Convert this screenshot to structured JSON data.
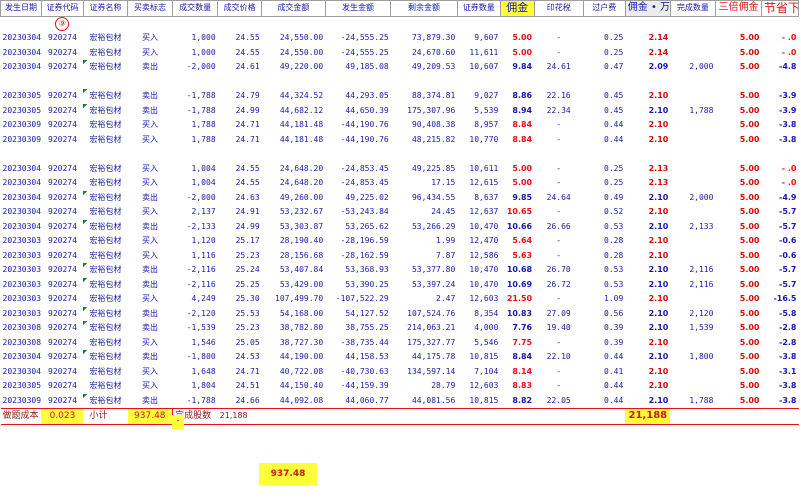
{
  "headers": [
    "发生日期",
    "证券代码",
    "证券名称",
    "买卖标志",
    "成交数量",
    "成交价格",
    "成交金额",
    "发生金额",
    "剩余金额",
    "证券数量",
    "佣金",
    "印花税",
    "过户费",
    "佣金 • 万",
    "完成数量",
    "三倍佣金",
    "节省下"
  ],
  "circle_marker": "⑨",
  "rows": [
    [
      "20230304",
      "920274",
      "宏裕包材",
      "买入",
      "1,000",
      "24.55",
      "24,550.00",
      "-24,555.25",
      "73,879.30",
      "9,607",
      "5.00",
      "-",
      "0.25",
      "2.14",
      "",
      "5.00",
      "- .0"
    ],
    [
      "20230304",
      "920274",
      "宏裕包材",
      "买入",
      "1,000",
      "24.55",
      "24,550.00",
      "-24,555.25",
      "24,670.60",
      "11,611",
      "5.00",
      "-",
      "0.25",
      "2.14",
      "",
      "5.00",
      "- .0"
    ],
    [
      "20230304",
      "920274",
      "宏裕包材",
      "卖出",
      "-2,000",
      "24.61",
      "49,220.00",
      "49,185.08",
      "49,209.53",
      "10,607",
      "9.84",
      "24.61",
      "0.47",
      "2.09",
      "2,000",
      "5.00",
      "-4.8"
    ],
    null,
    [
      "20230305",
      "920274",
      "宏裕包材",
      "卖出",
      "-1,788",
      "24.79",
      "44,324.52",
      "44,293.05",
      "88,374.81",
      "9,027",
      "8.86",
      "22.16",
      "0.45",
      "2.10",
      "",
      "5.00",
      "-3.9"
    ],
    [
      "20230305",
      "920274",
      "宏裕包材",
      "卖出",
      "-1,788",
      "24.99",
      "44,682.12",
      "44,650.39",
      "175,307.96",
      "5,539",
      "8.94",
      "22.34",
      "0.45",
      "2.10",
      "1,788",
      "5.00",
      "-3.9"
    ],
    [
      "20230309",
      "920274",
      "宏裕包材",
      "买入",
      "1,788",
      "24.71",
      "44,181.48",
      "-44,190.76",
      "90,408.38",
      "8,957",
      "8.84",
      "-",
      "0.44",
      "2.10",
      "",
      "5.00",
      "-3.8"
    ],
    [
      "20230309",
      "920274",
      "宏裕包材",
      "买入",
      "1,788",
      "24.71",
      "44,181.48",
      "-44,190.76",
      "48,215.82",
      "10,770",
      "8.84",
      "-",
      "0.44",
      "2.10",
      "",
      "5.00",
      "-3.8"
    ],
    null,
    [
      "20230304",
      "920274",
      "宏裕包材",
      "买入",
      "1,004",
      "24.55",
      "24,648.20",
      "-24,853.45",
      "49,225.85",
      "10,611",
      "5.00",
      "-",
      "0.25",
      "2.13",
      "",
      "5.00",
      "- .0"
    ],
    [
      "20230304",
      "920274",
      "宏裕包材",
      "买入",
      "1,004",
      "24.55",
      "24,648.20",
      "-24,853.45",
      "17.15",
      "12,615",
      "5.00",
      "-",
      "0.25",
      "2.13",
      "",
      "5.00",
      "- .0"
    ],
    [
      "20230304",
      "920274",
      "宏裕包材",
      "卖出",
      "-2,000",
      "24.63",
      "49,260.00",
      "49,225.02",
      "96,434.55",
      "8,637",
      "9.85",
      "24.64",
      "0.49",
      "2.10",
      "2,000",
      "5.00",
      "-4.9"
    ],
    [
      "20230304",
      "920274",
      "宏裕包材",
      "买入",
      "2,137",
      "24.91",
      "53,232.67",
      "-53,243.84",
      "24.45",
      "12,637",
      "10.65",
      "-",
      "0.52",
      "2.10",
      "",
      "5.00",
      "-5.7"
    ],
    [
      "20230304",
      "920274",
      "宏裕包材",
      "卖出",
      "-2,133",
      "24.99",
      "53,303.87",
      "53,265.62",
      "53,266.29",
      "10,470",
      "10.66",
      "26.66",
      "0.53",
      "2.10",
      "2,133",
      "5.00",
      "-5.7"
    ],
    [
      "20230303",
      "920274",
      "宏裕包材",
      "买入",
      "1,120",
      "25.17",
      "28,190.40",
      "-28,196.59",
      "1.99",
      "12,470",
      "5.64",
      "-",
      "0.28",
      "2.10",
      "",
      "5.00",
      "-0.6"
    ],
    [
      "20230303",
      "920274",
      "宏裕包材",
      "买入",
      "1,116",
      "25.23",
      "28,156.68",
      "-28,162.59",
      "7.87",
      "12,586",
      "5.63",
      "-",
      "0.28",
      "2.10",
      "",
      "5.00",
      "-0.6"
    ],
    [
      "20230303",
      "920274",
      "宏裕包材",
      "卖出",
      "-2,116",
      "25.24",
      "53,407.84",
      "53,368.93",
      "53,377.80",
      "10,470",
      "10.68",
      "26.70",
      "0.53",
      "2.10",
      "2,116",
      "5.00",
      "-5.7"
    ],
    [
      "20230303",
      "920274",
      "宏裕包材",
      "卖出",
      "-2,116",
      "25.25",
      "53,429.00",
      "53,390.25",
      "53,397.24",
      "10,470",
      "10.69",
      "26.72",
      "0.53",
      "2.10",
      "2,116",
      "5.00",
      "-5.7"
    ],
    [
      "20230303",
      "920274",
      "宏裕包材",
      "买入",
      "4,249",
      "25.30",
      "107,499.70",
      "-107,522.29",
      "2.47",
      "12,603",
      "21.50",
      "-",
      "1.09",
      "2.10",
      "",
      "5.00",
      "-16.5"
    ],
    [
      "20230303",
      "920274",
      "宏裕包材",
      "卖出",
      "-2,120",
      "25.53",
      "54,168.00",
      "54,127.52",
      "107,524.76",
      "8,354",
      "10.83",
      "27.09",
      "0.56",
      "2.10",
      "2,120",
      "5.00",
      "-5.8"
    ],
    [
      "20230308",
      "920274",
      "宏裕包材",
      "卖出",
      "-1,539",
      "25.23",
      "38,782.80",
      "38,755.25",
      "214,063.21",
      "4,000",
      "7.76",
      "19.40",
      "0.39",
      "2.10",
      "1,539",
      "5.00",
      "-2.8"
    ],
    [
      "20230308",
      "920274",
      "宏裕包材",
      "买入",
      "1,546",
      "25.05",
      "38,727.30",
      "-38,735.44",
      "175,327.77",
      "5,546",
      "7.75",
      "-",
      "0.39",
      "2.10",
      "",
      "5.00",
      "-2.8"
    ],
    [
      "20230304",
      "920274",
      "宏裕包材",
      "卖出",
      "-1,800",
      "24.53",
      "44,190.00",
      "44,158.53",
      "44,175.78",
      "10,815",
      "8.84",
      "22.10",
      "0.44",
      "2.10",
      "1,800",
      "5.00",
      "-3.8"
    ],
    [
      "20230304",
      "920274",
      "宏裕包材",
      "买入",
      "1,648",
      "24.71",
      "40,722.08",
      "-40,730.63",
      "134,597.14",
      "7,104",
      "8.14",
      "-",
      "0.41",
      "2.10",
      "",
      "5.00",
      "-3.1"
    ],
    [
      "20230305",
      "920274",
      "宏裕包材",
      "买入",
      "1,804",
      "24.51",
      "44,150.40",
      "-44,159.39",
      "28.79",
      "12,603",
      "8.83",
      "-",
      "0.44",
      "2.10",
      "",
      "5.00",
      "-3.8"
    ],
    [
      "20230309",
      "920274",
      "宏裕包材",
      "卖出",
      "-1,788",
      "24.66",
      "44,092.08",
      "44,060.77",
      "44,081.56",
      "10,815",
      "8.82",
      "22.05",
      "0.44",
      "2.10",
      "1,788",
      "5.00",
      "-3.8"
    ]
  ],
  "dash_mark": "-",
  "summary": {
    "cost_label": "做题成本",
    "cost_value": "0.023",
    "subtotal_label": "小计",
    "subtotal_value": "937.48",
    "done_label": "完成股数",
    "done_value": "21,188",
    "commission_total": "21,188"
  },
  "grand_total": "937.48",
  "colors": {
    "accent_yellow": "#ffff3c",
    "red": "#e8101a",
    "blue": "#1a1aa8",
    "green_marker": "#1a7f37"
  }
}
